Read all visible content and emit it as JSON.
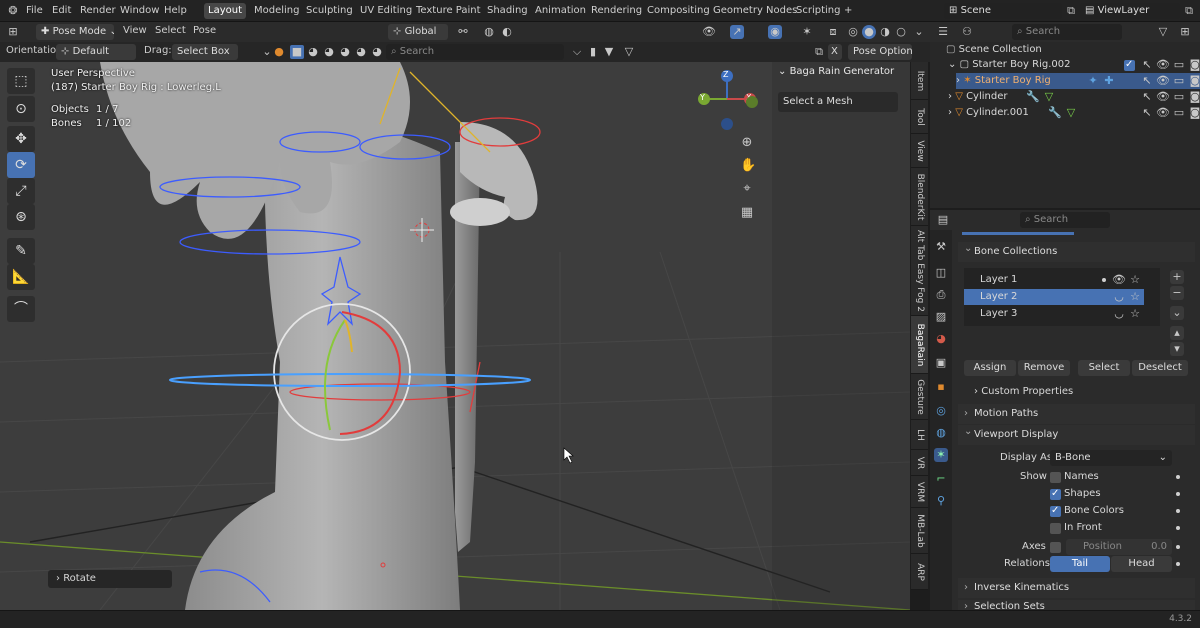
{
  "menu": [
    "File",
    "Edit",
    "Render",
    "Window",
    "Help"
  ],
  "workspaces": [
    {
      "label": "Layout",
      "active": true
    },
    {
      "label": "Modeling"
    },
    {
      "label": "Sculpting"
    },
    {
      "label": "UV Editing"
    },
    {
      "label": "Texture Paint"
    },
    {
      "label": "Shading"
    },
    {
      "label": "Animation"
    },
    {
      "label": "Rendering"
    },
    {
      "label": "Compositing"
    },
    {
      "label": "Geometry Nodes"
    },
    {
      "label": "Scripting"
    },
    {
      "label": "+"
    }
  ],
  "scene": {
    "label": "Scene",
    "view_layer": "ViewLayer"
  },
  "header": {
    "mode": "Pose Mode",
    "view": "View",
    "select": "Select",
    "pose": "Pose",
    "transform": "Global"
  },
  "toolbar2": {
    "orientation_label": "Orientation:",
    "orientation_value": "Default",
    "drag_label": "Drag:",
    "drag_value": "Select Box",
    "search_placeholder": "Search",
    "pose_options": "Pose Options",
    "close": "X"
  },
  "viewport": {
    "perspective": "User Perspective",
    "active_object": "(187) Starter Boy Rig : Lowerleg.L",
    "objects_label": "Objects",
    "objects_value": "1 / 7",
    "bones_label": "Bones",
    "bones_value": "1 / 102",
    "last_op": "Rotate",
    "axes": {
      "x": "X",
      "y": "Y",
      "z": "Z"
    }
  },
  "sidepanel": {
    "title": "Baga Rain Generator",
    "select_mesh": "Select a Mesh"
  },
  "vtabs": [
    "Item",
    "Tool",
    "View",
    "BlenderKit",
    "Alt Tab Easy Fog 2",
    "BagaRain",
    "Gesture",
    "LH",
    "VR",
    "VRM",
    "MB-Lab",
    "ARP"
  ],
  "outliner": {
    "search_placeholder": "Search",
    "root": "Scene Collection",
    "items": [
      {
        "label": "Starter Boy Rig.002",
        "indent": 0
      },
      {
        "label": "Starter Boy Rig",
        "indent": 1,
        "selected": true
      },
      {
        "label": "Cylinder",
        "indent": 1
      },
      {
        "label": "Cylinder.001",
        "indent": 1
      }
    ]
  },
  "properties": {
    "search_placeholder": "Search",
    "bone_collections": "Bone Collections",
    "layers": [
      {
        "label": "Layer 1"
      },
      {
        "label": "Layer 2",
        "selected": true
      },
      {
        "label": "Layer 3"
      }
    ],
    "assign": "Assign",
    "remove": "Remove",
    "select": "Select",
    "deselect": "Deselect",
    "custom_properties": "Custom Properties",
    "motion_paths": "Motion Paths",
    "viewport_display": "Viewport Display",
    "display_as_label": "Display As",
    "display_as_value": "B-Bone",
    "show_label": "Show",
    "show_items": [
      {
        "label": "Names",
        "on": false
      },
      {
        "label": "Shapes",
        "on": true
      },
      {
        "label": "Bone Colors",
        "on": true
      },
      {
        "label": "In Front",
        "on": false
      }
    ],
    "axes_label": "Axes",
    "position_label": "Position",
    "position_value": "0.0",
    "relations_label": "Relations",
    "tail": "Tail",
    "head": "Head",
    "inverse_kinematics": "Inverse Kinematics",
    "selection_sets": "Selection Sets"
  },
  "version": "4.3.2",
  "colors": {
    "accent": "#4772b3",
    "x_axis": "#c94a4a",
    "y_axis": "#7aa832",
    "z_axis": "#3d6fc1",
    "orange": "#e08a2e"
  }
}
